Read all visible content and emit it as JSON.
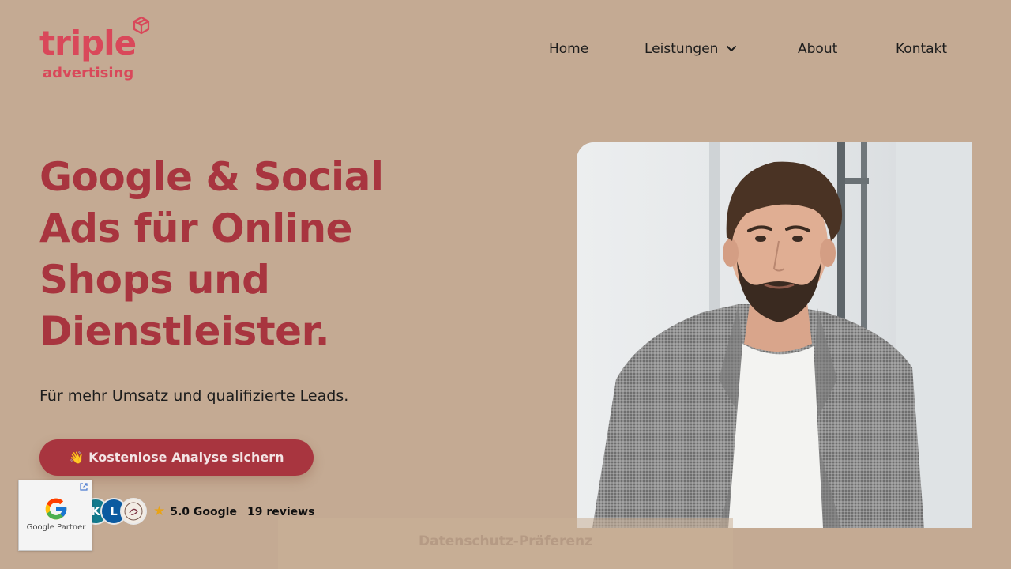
{
  "logo": {
    "main": "triple",
    "sub": "advertising"
  },
  "nav": {
    "items": [
      {
        "label": "Home"
      },
      {
        "label": "Leistungen",
        "has_dropdown": true
      },
      {
        "label": "About"
      },
      {
        "label": "Kontakt"
      }
    ]
  },
  "hero": {
    "headline": "Google & Social Ads für Online Shops und Dienstleister.",
    "subline": "Für mehr Umsatz und qualifizierte Leads.",
    "cta_label": "Kostenlose Analyse sichern",
    "cta_icon": "waving-hand-icon"
  },
  "reviews": {
    "avatars": [
      {
        "initial": "K",
        "color": "#127a8c"
      },
      {
        "initial": "L",
        "color": "#0b5aa0"
      },
      {
        "initial": "",
        "color": "#f2ece4"
      }
    ],
    "rating": "5.0 Google",
    "count": "19 reviews"
  },
  "badge": {
    "label": "Google Partner"
  },
  "consent": {
    "label": "Datenschutz-Präferenz"
  },
  "colors": {
    "background": "#c4aa93",
    "accent": "#a8353f",
    "logo": "#d9485a"
  }
}
